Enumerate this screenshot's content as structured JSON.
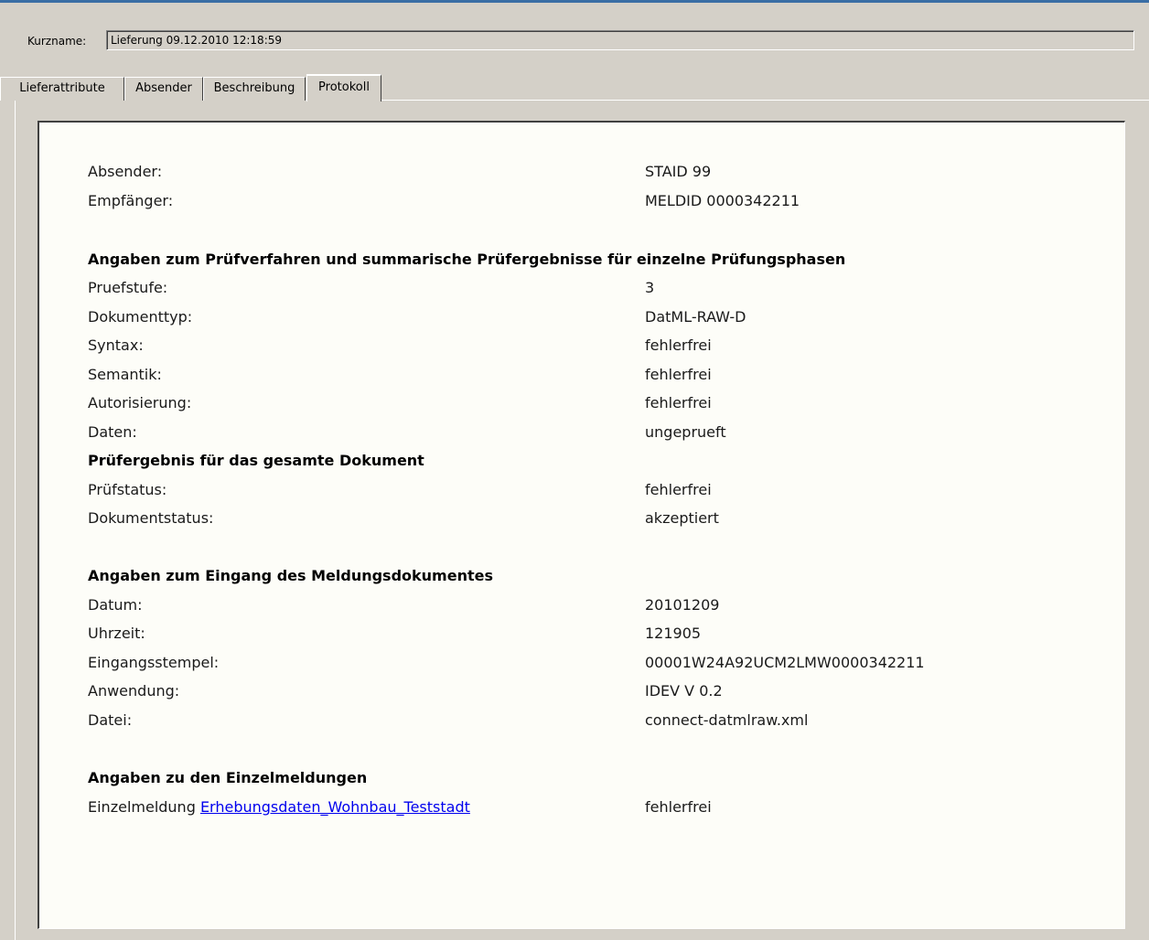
{
  "header": {
    "shortname_label": "Kurzname:",
    "shortname_value": "Lieferung 09.12.2010 12:18:59"
  },
  "tabs": [
    {
      "label": "Lieferattribute",
      "active": false
    },
    {
      "label": "Absender",
      "active": false
    },
    {
      "label": "Beschreibung",
      "active": false
    },
    {
      "label": "Protokoll",
      "active": true
    }
  ],
  "protocol": {
    "sender": {
      "absender_label": "Absender:",
      "absender_value": "STAID 99",
      "empfaenger_label": "Empfänger:",
      "empfaenger_value": "MELDID 0000342211"
    },
    "check_section": {
      "heading": "Angaben zum Prüfverfahren und summarische Prüfergebnisse für einzelne Prüfungsphasen",
      "rows": [
        {
          "label": "Pruefstufe:",
          "value": "3"
        },
        {
          "label": "Dokumenttyp:",
          "value": "DatML-RAW-D"
        },
        {
          "label": "Syntax:",
          "value": "fehlerfrei"
        },
        {
          "label": "Semantik:",
          "value": "fehlerfrei"
        },
        {
          "label": "Autorisierung:",
          "value": "fehlerfrei"
        },
        {
          "label": "Daten:",
          "value": "ungeprueft"
        }
      ]
    },
    "result_section": {
      "heading": "Prüfergebnis für das gesamte Dokument",
      "rows": [
        {
          "label": "Prüfstatus:",
          "value": "fehlerfrei"
        },
        {
          "label": "Dokumentstatus:",
          "value": "akzeptiert"
        }
      ]
    },
    "receipt_section": {
      "heading": "Angaben zum Eingang des Meldungsdokumentes",
      "rows": [
        {
          "label": "Datum:",
          "value": "20101209"
        },
        {
          "label": "Uhrzeit:",
          "value": "121905"
        },
        {
          "label": "Eingangsstempel:",
          "value": "00001W24A92UCM2LMW0000342211"
        },
        {
          "label": "Anwendung:",
          "value": "IDEV V 0.2"
        },
        {
          "label": "Datei:",
          "value": "connect-datmlraw.xml"
        }
      ]
    },
    "single_section": {
      "heading": "Angaben zu den Einzelmeldungen",
      "prefix": "Einzelmeldung",
      "link": "Erhebungsdaten_Wohnbau_Teststadt",
      "value": "fehlerfrei"
    }
  }
}
